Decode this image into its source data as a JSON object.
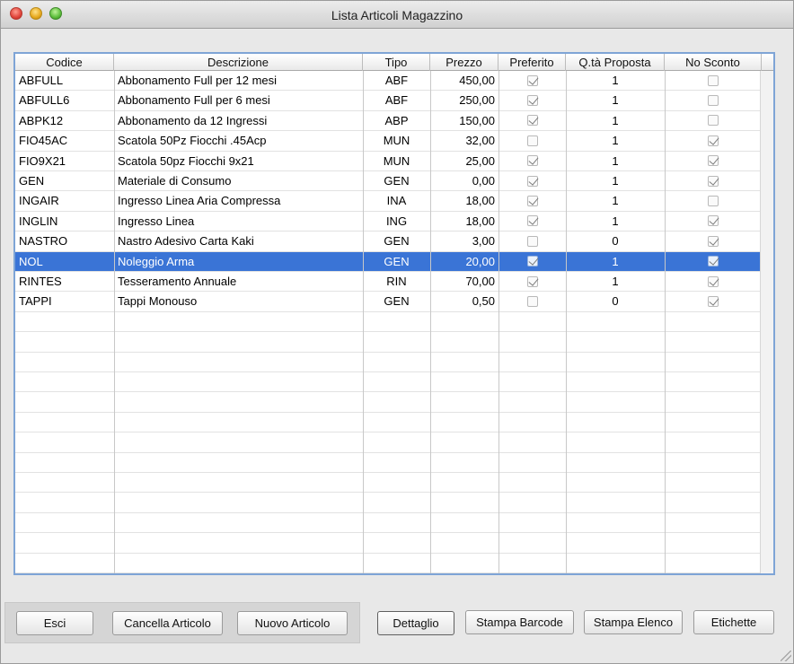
{
  "window": {
    "title": "Lista Articoli Magazzino"
  },
  "table": {
    "columns": [
      "Codice",
      "Descrizione",
      "Tipo",
      "Prezzo",
      "Preferito",
      "Q.tà Proposta",
      "No Sconto"
    ],
    "rows": [
      {
        "codice": "ABFULL",
        "descrizione": "Abbonamento Full per 12 mesi",
        "tipo": "ABF",
        "prezzo": "450,00",
        "preferito": true,
        "qta": "1",
        "no_sconto": false
      },
      {
        "codice": "ABFULL6",
        "descrizione": "Abbonamento Full per 6 mesi",
        "tipo": "ABF",
        "prezzo": "250,00",
        "preferito": true,
        "qta": "1",
        "no_sconto": false
      },
      {
        "codice": "ABPK12",
        "descrizione": "Abbonamento da 12 Ingressi",
        "tipo": "ABP",
        "prezzo": "150,00",
        "preferito": true,
        "qta": "1",
        "no_sconto": false
      },
      {
        "codice": "FIO45AC",
        "descrizione": "Scatola 50Pz Fiocchi .45Acp",
        "tipo": "MUN",
        "prezzo": "32,00",
        "preferito": false,
        "qta": "1",
        "no_sconto": true
      },
      {
        "codice": "FIO9X21",
        "descrizione": "Scatola 50pz Fiocchi 9x21",
        "tipo": "MUN",
        "prezzo": "25,00",
        "preferito": true,
        "qta": "1",
        "no_sconto": true
      },
      {
        "codice": "GEN",
        "descrizione": "Materiale di Consumo",
        "tipo": "GEN",
        "prezzo": "0,00",
        "preferito": true,
        "qta": "1",
        "no_sconto": true
      },
      {
        "codice": "INGAIR",
        "descrizione": "Ingresso Linea Aria Compressa",
        "tipo": "INA",
        "prezzo": "18,00",
        "preferito": true,
        "qta": "1",
        "no_sconto": false
      },
      {
        "codice": "INGLIN",
        "descrizione": "Ingresso Linea",
        "tipo": "ING",
        "prezzo": "18,00",
        "preferito": true,
        "qta": "1",
        "no_sconto": true
      },
      {
        "codice": "NASTRO",
        "descrizione": "Nastro Adesivo Carta Kaki",
        "tipo": "GEN",
        "prezzo": "3,00",
        "preferito": false,
        "qta": "0",
        "no_sconto": true
      },
      {
        "codice": "NOL",
        "descrizione": "Noleggio Arma",
        "tipo": "GEN",
        "prezzo": "20,00",
        "preferito": true,
        "qta": "1",
        "no_sconto": true,
        "selected": true
      },
      {
        "codice": "RINTES",
        "descrizione": "Tesseramento Annuale",
        "tipo": "RIN",
        "prezzo": "70,00",
        "preferito": true,
        "qta": "1",
        "no_sconto": true
      },
      {
        "codice": "TAPPI",
        "descrizione": "Tappi Monouso",
        "tipo": "GEN",
        "prezzo": "0,50",
        "preferito": false,
        "qta": "0",
        "no_sconto": true
      }
    ],
    "selection_color": "#3a74d6"
  },
  "buttons": {
    "esci": "Esci",
    "cancella": "Cancella Articolo",
    "nuovo": "Nuovo Articolo",
    "dettaglio": "Dettaglio",
    "stampa_barcode": "Stampa Barcode",
    "stampa_elenco": "Stampa Elenco",
    "etichette": "Etichette"
  }
}
